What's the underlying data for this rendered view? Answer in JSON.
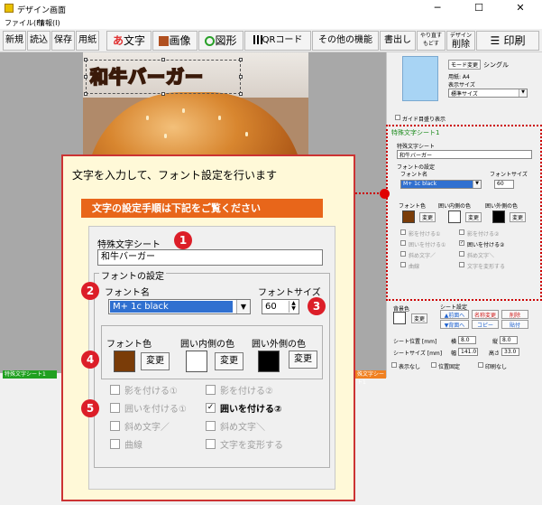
{
  "window": {
    "title": "デザイン画面",
    "controls": [
      "─",
      "☐",
      "✕"
    ]
  },
  "menu": {
    "items": [
      "ファイル(F)",
      "情報(I)"
    ]
  },
  "toolbar": {
    "new": "新規",
    "load": "読込",
    "save": "保存",
    "paper": "用紙",
    "text": "文字",
    "text_prefix": "あ",
    "image": "画像",
    "shape": "図形",
    "qr": "QRコード",
    "other": "その他の機能",
    "write": "書出し",
    "redo": "やり直す",
    "undo": "もどす",
    "design_delete_top": "デザイン",
    "design_delete": "削除",
    "print": "印刷"
  },
  "canvas": {
    "text_object": "和牛バーガー"
  },
  "right_panel": {
    "mode_change": "モード変更",
    "mode_value": "シングル",
    "paper_label": "用紙: A4",
    "display_size_label": "表示サイズ",
    "display_size_value": "標準サイズ",
    "guide_checkbox": "ガイド目盛り表示",
    "section_title": "特殊文字シート1",
    "sheet_label": "特殊文字シート",
    "sheet_value": "和牛バーガー",
    "font_settings": "フォントの設定",
    "font_name_label": "フォント名",
    "font_name_value": "M+ 1c black",
    "font_size_label": "フォントサイズ",
    "font_size_value": "60",
    "font_color": "フォント色",
    "inner_color": "囲い内側の色",
    "outer_color": "囲い外側の色",
    "change": "変更",
    "options": [
      "影を付ける①",
      "影を付ける②",
      "囲いを付ける①",
      "囲いを付ける②",
      "斜め文字／",
      "斜め文字＼",
      "曲線",
      "文字を変形する"
    ],
    "bg_color": "背景色",
    "sheet_settings": "シート設定",
    "front": "▲前面へ",
    "back": "▼背面へ",
    "rename": "名称変更",
    "copy": "コピー",
    "delete": "削除",
    "paste": "貼付",
    "sheet_position": "シート位置 [mm]",
    "horizontal": "横",
    "horizontal_value": "8.0",
    "vertical": "縦",
    "vertical_value": "8.0",
    "sheet_size": "シートサイズ [mm]",
    "width": "幅",
    "width_value": "141.0",
    "height": "高さ",
    "height_value": "33.0",
    "hide": "表示なし",
    "fix_position": "位置固定",
    "no_print": "印刷なし"
  },
  "status": {
    "left_tab": "特殊文字シート1",
    "right_tab": "殊文字シート1"
  },
  "callout": {
    "title": "文字を入力して、フォント設定を行います",
    "subtitle": "文字の設定手順は下記をご覧ください",
    "sheet_label": "特殊文字シート",
    "sheet_value": "和牛バーガー",
    "font_settings": "フォントの設定",
    "font_name_label": "フォント名",
    "font_name_value": "M+ 1c black",
    "font_size_label": "フォントサイズ",
    "font_size_value": "60",
    "font_color": "フォント色",
    "inner_color": "囲い内側の色",
    "outer_color": "囲い外側の色",
    "change": "変更",
    "options": [
      "影を付ける①",
      "影を付ける②",
      "囲いを付ける①",
      "囲いを付ける②",
      "斜め文字／",
      "斜め文字＼",
      "曲線",
      "文字を変形する"
    ],
    "badges": [
      "1",
      "2",
      "3",
      "4",
      "5"
    ]
  },
  "colors": {
    "font_color": "#7a3c08",
    "inner_color": "#ffffff",
    "outer_color": "#000000",
    "accent_red": "#dc1e28",
    "orange": "#e8661a"
  }
}
